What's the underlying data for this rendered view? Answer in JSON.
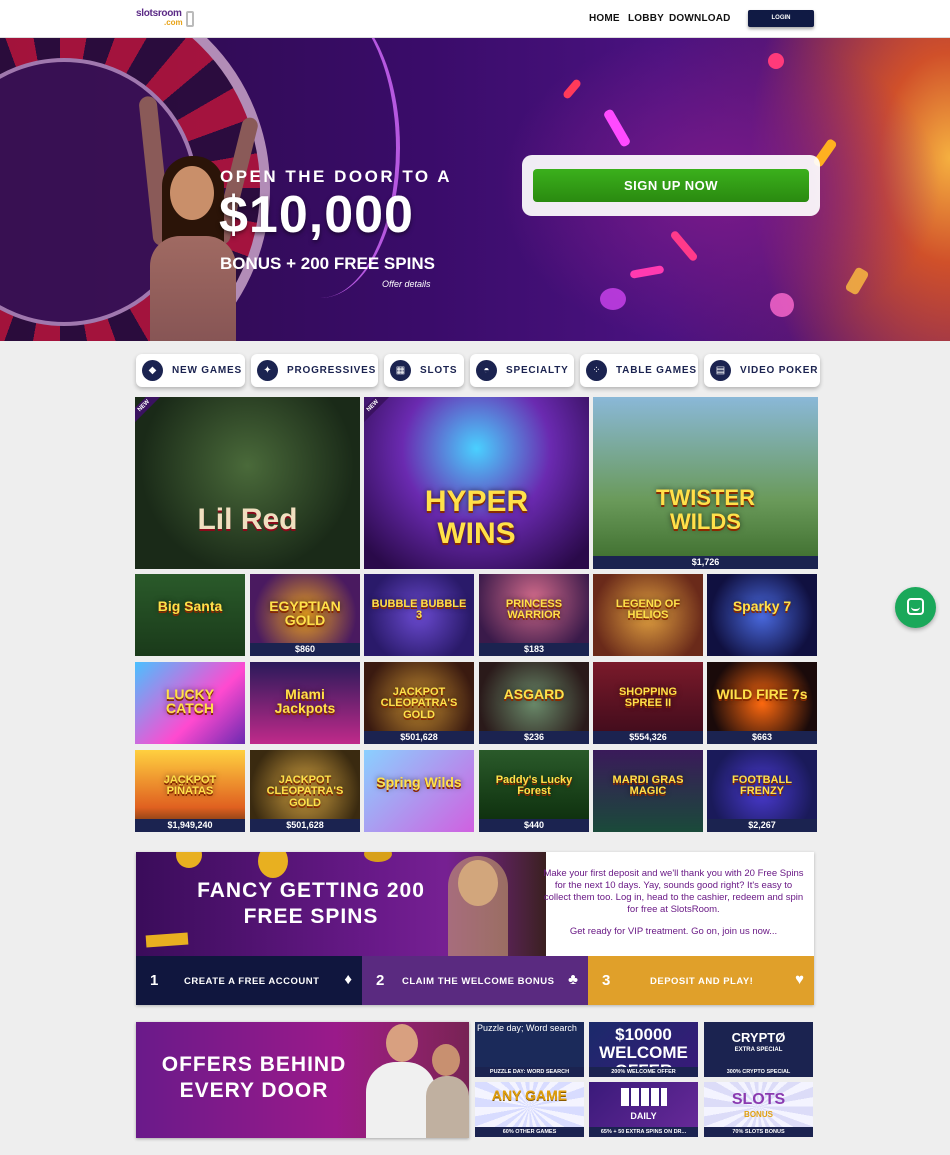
{
  "header": {
    "logo_text": "slotsroom",
    "logo_suffix": ".com",
    "nav": [
      "HOME",
      "LOBBY",
      "DOWNLOAD"
    ],
    "login_label": "LOGIN"
  },
  "hero": {
    "line1": "OPEN THE DOOR TO A",
    "amount": "$10,000",
    "line3": "BONUS + 200 FREE SPINS",
    "offer_link": "Offer details",
    "signup_label": "SIGN UP NOW"
  },
  "categories": [
    {
      "label": "NEW GAMES",
      "icon": "diamond-icon"
    },
    {
      "label": "PROGRESSIVES",
      "icon": "sparkle-icon"
    },
    {
      "label": "SLOTS",
      "icon": "slot-machine-icon"
    },
    {
      "label": "SPECIALTY",
      "icon": "dish-icon"
    },
    {
      "label": "TABLE GAMES",
      "icon": "chips-icon"
    },
    {
      "label": "VIDEO POKER",
      "icon": "cards-icon"
    }
  ],
  "featured_games": [
    {
      "name": "Lil Red",
      "jackpot": "",
      "badge": "NEW"
    },
    {
      "name": "HYPER WINS",
      "jackpot": "",
      "badge": "NEW"
    },
    {
      "name": "TWISTER WILDS",
      "jackpot": "$1,726",
      "badge": ""
    }
  ],
  "games": [
    {
      "name": "Big Santa",
      "jackpot": ""
    },
    {
      "name": "EGYPTIAN GOLD",
      "jackpot": "$860"
    },
    {
      "name": "BUBBLE BUBBLE 3",
      "jackpot": ""
    },
    {
      "name": "PRINCESS WARRIOR",
      "jackpot": "$183"
    },
    {
      "name": "LEGEND OF HELIOS",
      "jackpot": ""
    },
    {
      "name": "Sparky 7",
      "jackpot": ""
    },
    {
      "name": "LUCKY CATCH",
      "jackpot": ""
    },
    {
      "name": "Miami Jackpots",
      "jackpot": ""
    },
    {
      "name": "JACKPOT CLEOPATRA'S GOLD",
      "jackpot": "$501,628"
    },
    {
      "name": "ASGARD",
      "jackpot": "$236"
    },
    {
      "name": "SHOPPING SPREE II",
      "jackpot": "$554,326"
    },
    {
      "name": "WILD FIRE 7s",
      "jackpot": "$663"
    },
    {
      "name": "JACKPOT PIÑATAS",
      "jackpot": "$1,949,240"
    },
    {
      "name": "JACKPOT CLEOPATRA'S GOLD",
      "jackpot": "$501,628"
    },
    {
      "name": "Spring Wilds",
      "jackpot": ""
    },
    {
      "name": "Paddy's Lucky Forest",
      "jackpot": "$440"
    },
    {
      "name": "MARDI GRAS MAGIC",
      "jackpot": ""
    },
    {
      "name": "FOOTBALL FRENZY",
      "jackpot": "$2,267"
    }
  ],
  "promo": {
    "title": "FANCY GETTING 200 FREE SPINS",
    "text1": "Make your first deposit and we'll thank you with 20 Free Spins for the next 10 days. Yay, sounds good right? It's easy to collect them too. Log in, head to the cashier, redeem and spin for free at SlotsRoom.",
    "text2": "Get ready for VIP treatment. Go on, join us now...",
    "steps": [
      {
        "num": "1",
        "label": "CREATE A FREE ACCOUNT",
        "symbol": "♦"
      },
      {
        "num": "2",
        "label": "CLAIM THE WELCOME BONUS",
        "symbol": "♣"
      },
      {
        "num": "3",
        "label": "DEPOSIT AND PLAY!",
        "symbol": "♥"
      }
    ]
  },
  "offers": {
    "title": "OFFERS BEHIND EVERY DOOR",
    "tiles": [
      {
        "big": "Puzzle day; Word search",
        "caption": "PUZZLE DAY: WORD SEARCH"
      },
      {
        "big": "$10000 WELCOME OFFER",
        "caption": "200% WELCOME OFFER"
      },
      {
        "big": "CRYPTØ",
        "sub": "EXTRA SPECIAL",
        "caption": "300% CRYPTO SPECIAL"
      },
      {
        "big": "ANY GAME",
        "caption": "60% OTHER GAMES"
      },
      {
        "big": "DAILY",
        "caption": "65% + 50 EXTRA SPINS ON DR..."
      },
      {
        "big": "SLOTS",
        "sub": "BONUS",
        "caption": "70% SLOTS BONUS"
      }
    ]
  },
  "colors": {
    "navy": "#1b2350",
    "green": "#2ea015",
    "purple": "#5b2a86",
    "gold": "#e0a02a"
  }
}
